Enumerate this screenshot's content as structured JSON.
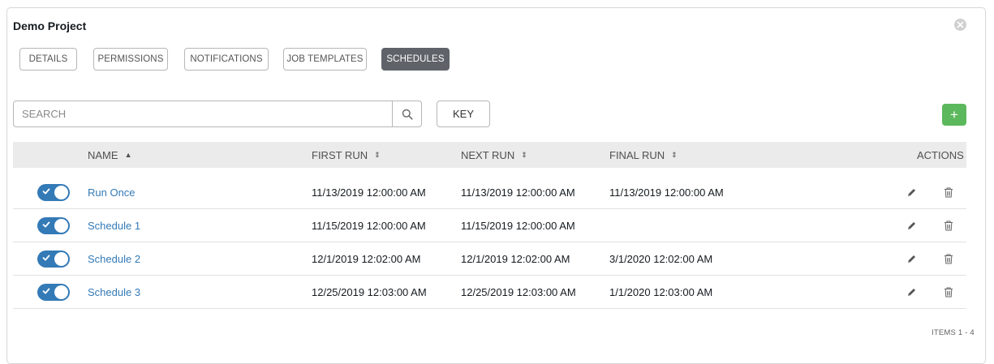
{
  "panel": {
    "title": "Demo Project"
  },
  "tabs": [
    {
      "label": "DETAILS",
      "active": false
    },
    {
      "label": "PERMISSIONS",
      "active": false
    },
    {
      "label": "NOTIFICATIONS",
      "active": false
    },
    {
      "label": "JOB TEMPLATES",
      "active": false
    },
    {
      "label": "SCHEDULES",
      "active": true
    }
  ],
  "search": {
    "placeholder": "SEARCH",
    "value": ""
  },
  "toolbar": {
    "key_label": "KEY",
    "add_label": "+"
  },
  "table": {
    "columns": {
      "name": "NAME",
      "first_run": "FIRST RUN",
      "next_run": "NEXT RUN",
      "final_run": "FINAL RUN",
      "actions": "ACTIONS"
    },
    "rows": [
      {
        "enabled": true,
        "name": "Run Once",
        "first_run": "11/13/2019 12:00:00 AM",
        "next_run": "11/13/2019 12:00:00 AM",
        "final_run": "11/13/2019 12:00:00 AM"
      },
      {
        "enabled": true,
        "name": "Schedule 1",
        "first_run": "11/15/2019 12:00:00 AM",
        "next_run": "11/15/2019 12:00:00 AM",
        "final_run": ""
      },
      {
        "enabled": true,
        "name": "Schedule 2",
        "first_run": "12/1/2019 12:02:00 AM",
        "next_run": "12/1/2019 12:02:00 AM",
        "final_run": "3/1/2020 12:02:00 AM"
      },
      {
        "enabled": true,
        "name": "Schedule 3",
        "first_run": "12/25/2019 12:03:00 AM",
        "next_run": "12/25/2019 12:03:00 AM",
        "final_run": "1/1/2020 12:03:00 AM"
      }
    ]
  },
  "footer": {
    "items_label": "ITEMS  1 - 4"
  },
  "colors": {
    "accent": "#337ab7",
    "add": "#5cb85c",
    "active_tab": "#5f6369"
  },
  "icons": {
    "close": "close-icon",
    "search": "search-icon",
    "sort_asc": "sort-up-icon",
    "sort": "sort-icon",
    "edit": "pencil-icon",
    "delete": "trash-icon",
    "toggle_check": "check-icon"
  }
}
